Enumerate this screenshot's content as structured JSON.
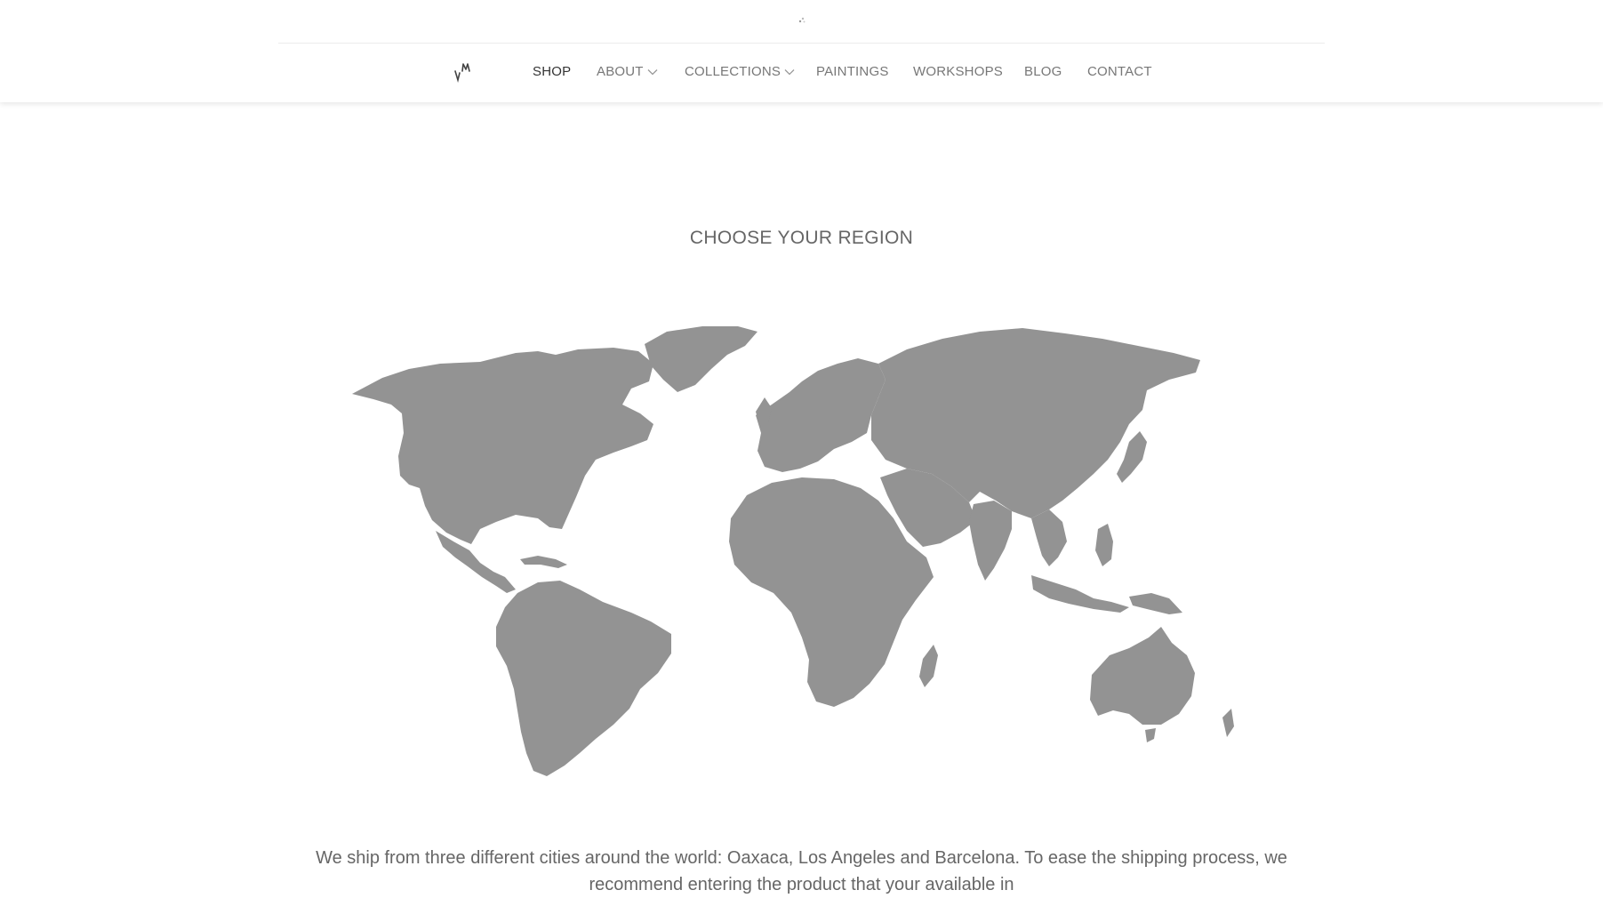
{
  "header": {
    "logo_icon": "vm-monogram-logo",
    "top_icon": "loading-spinner-icon",
    "nav": {
      "shop": "SHOP",
      "about": "ABOUT",
      "collections": "COLLECTIONS",
      "paintings": "PAINTINGS",
      "workshops": "WORKSHOPS",
      "blog": "BLOG",
      "contact": "CONTACT"
    },
    "active_item": "SHOP"
  },
  "main": {
    "title": "CHOOSE YOUR REGION",
    "map_icon": "world-map",
    "map_fill": "#939393",
    "shipping_text": "We ship from three different cities around the world: Oaxaca, Los Angeles and Barcelona. To ease the shipping process, we recommend entering the product that your available in"
  },
  "colors": {
    "nav_active": "#333333",
    "nav": "#777777",
    "text": "#666666",
    "background": "#ffffff"
  }
}
